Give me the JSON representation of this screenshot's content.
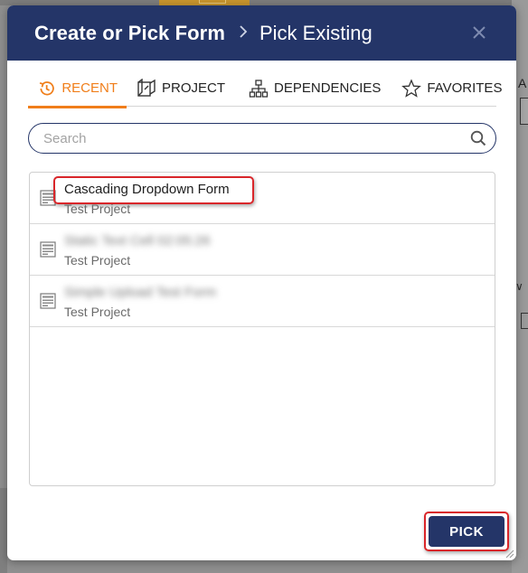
{
  "modal": {
    "title": "Create or Pick Form",
    "separator": ">",
    "subtitle": "Pick Existing",
    "close_icon": "close-icon"
  },
  "tabs": [
    {
      "label": "RECENT",
      "icon": "history-icon",
      "active": true
    },
    {
      "label": "PROJECT",
      "icon": "project-icon",
      "active": false
    },
    {
      "label": "DEPENDENCIES",
      "icon": "hierarchy-icon",
      "active": false
    },
    {
      "label": "FAVORITES",
      "icon": "star-icon",
      "active": false
    }
  ],
  "search": {
    "placeholder": "Search",
    "value": ""
  },
  "items": [
    {
      "name": "Cascading Dropdown Form",
      "project": "Test Project",
      "highlighted": true,
      "blurred": false
    },
    {
      "name": "Static Text Cell 02:05:26",
      "project": "Test Project",
      "highlighted": false,
      "blurred": true
    },
    {
      "name": "Simple Upload Test Form",
      "project": "Test Project",
      "highlighted": false,
      "blurred": true
    }
  ],
  "footer": {
    "pick_label": "PICK"
  },
  "colors": {
    "header_bg": "#243568",
    "accent": "#f07e1a",
    "highlight": "#d9262a"
  },
  "background": {
    "right_label": "A"
  }
}
